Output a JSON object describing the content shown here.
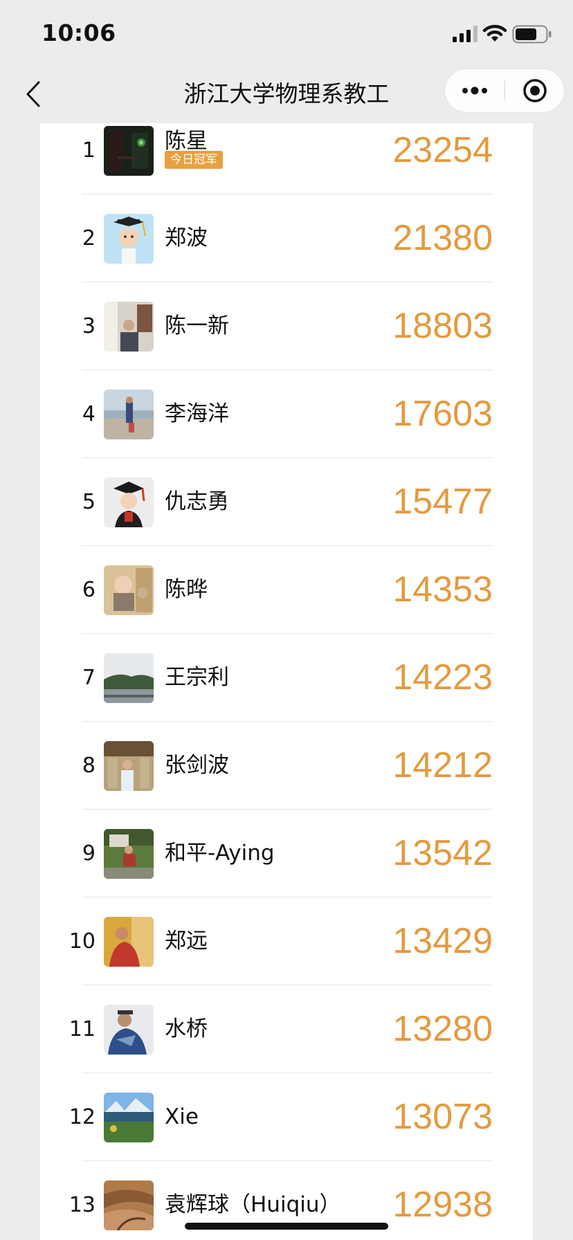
{
  "status_bar": {
    "time": "10:06"
  },
  "nav": {
    "title": "浙江大学物理系教工"
  },
  "champion_badge": "今日冠军",
  "rows": [
    {
      "rank": "1",
      "name": "陈星",
      "steps": "23254"
    },
    {
      "rank": "2",
      "name": "郑波",
      "steps": "21380"
    },
    {
      "rank": "3",
      "name": "陈一新",
      "steps": "18803"
    },
    {
      "rank": "4",
      "name": "李海洋",
      "steps": "17603"
    },
    {
      "rank": "5",
      "name": "仇志勇",
      "steps": "15477"
    },
    {
      "rank": "6",
      "name": "陈晔",
      "steps": "14353"
    },
    {
      "rank": "7",
      "name": "王宗利",
      "steps": "14223"
    },
    {
      "rank": "8",
      "name": "张剑波",
      "steps": "14212"
    },
    {
      "rank": "9",
      "name": "和平-Aying",
      "steps": "13542"
    },
    {
      "rank": "10",
      "name": "郑远",
      "steps": "13429"
    },
    {
      "rank": "11",
      "name": "水桥",
      "steps": "13280"
    },
    {
      "rank": "12",
      "name": "Xie",
      "steps": "13073"
    },
    {
      "rank": "13",
      "name": "袁辉球（Huiqiu）",
      "steps": "12938"
    }
  ],
  "colors": {
    "accent": "#e49a3e",
    "badge": "#e8a040",
    "page_bg": "#ececec"
  }
}
